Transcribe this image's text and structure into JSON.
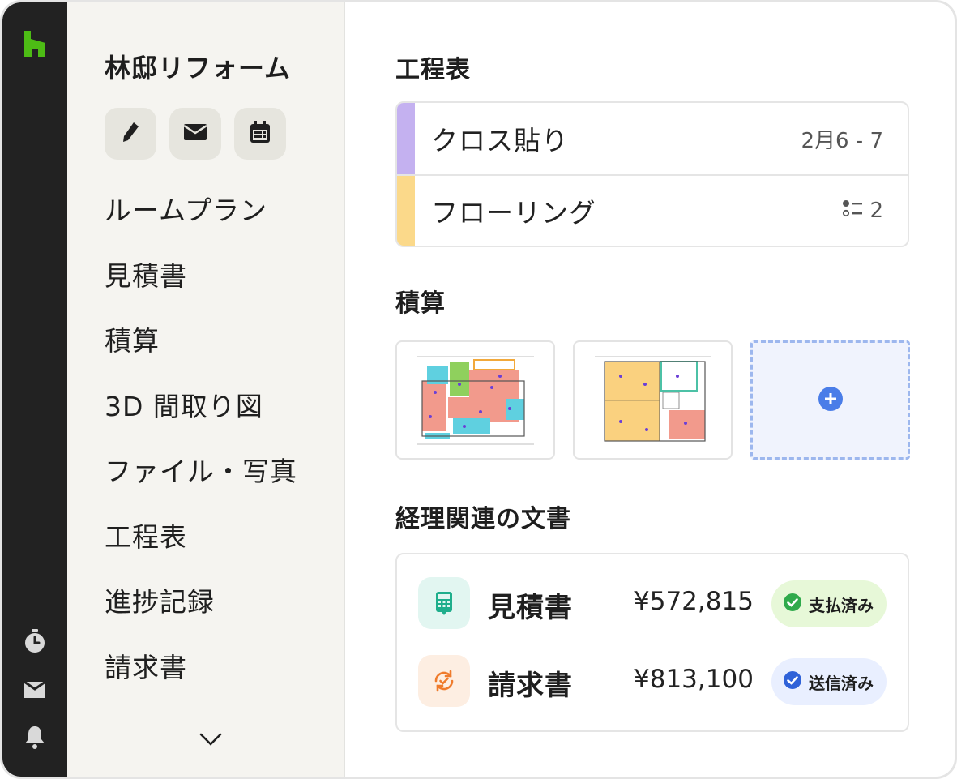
{
  "rail": {
    "icons": [
      "houzz-logo-icon",
      "stopwatch-icon",
      "inbox-icon",
      "bell-icon"
    ]
  },
  "sidebar": {
    "project_title": "林邸リフォーム",
    "actions": [
      "pencil-icon",
      "mail-icon",
      "calendar-icon"
    ],
    "nav_items": [
      {
        "label": "ルームプラン"
      },
      {
        "label": "見積書"
      },
      {
        "label": "積算"
      },
      {
        "label": "3D 間取り図"
      },
      {
        "label": "ファイル・写真"
      },
      {
        "label": "工程表"
      },
      {
        "label": "進捗記録"
      },
      {
        "label": "請求書"
      }
    ]
  },
  "main": {
    "schedule": {
      "title": "工程表",
      "rows": [
        {
          "name": "クロス貼り",
          "meta": "2月6 - 7",
          "color": "#c4b1f0"
        },
        {
          "name": "フローリング",
          "meta": "2",
          "color": "#fbd98a"
        }
      ]
    },
    "takeoff": {
      "title": "積算"
    },
    "finance": {
      "title": "経理関連の文書",
      "docs": [
        {
          "name": "見積書",
          "amount": "¥572,815",
          "status": "支払済み",
          "icon_bg": "#e2f6f1",
          "icon_color": "#1fae8c",
          "badge_bg": "#e7f8d8",
          "badge_icon_color": "#2faa4b"
        },
        {
          "name": "請求書",
          "amount": "¥813,100",
          "status": "送信済み",
          "icon_bg": "#fdeee2",
          "icon_color": "#ef7b2c",
          "badge_bg": "#e9efff",
          "badge_icon_color": "#2f62d8"
        }
      ]
    }
  },
  "colors": {
    "brand_green": "#4dbc15",
    "rail_bg": "#222222",
    "sidebar_bg": "#f5f4f0",
    "add_blue": "#4a7de8"
  }
}
